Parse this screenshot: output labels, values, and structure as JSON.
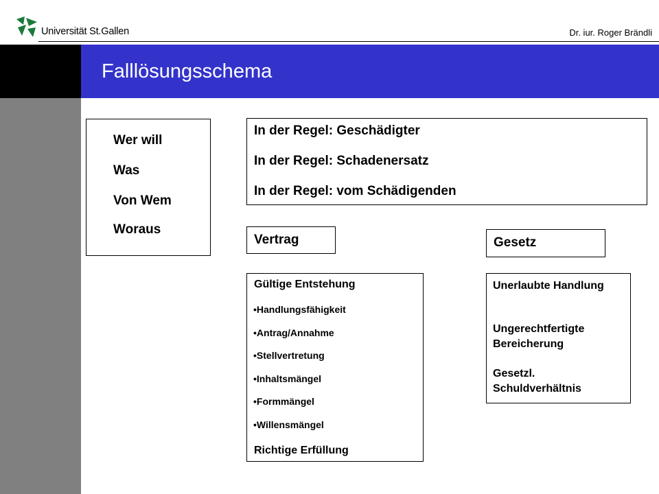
{
  "header": {
    "logo_text": "Universität St.Gallen",
    "author": "Dr. iur. Roger Brändli"
  },
  "slide": {
    "title": "Falllösungsschema"
  },
  "questions": [
    "Wer will",
    "Was",
    "Von Wem",
    "Woraus"
  ],
  "rules": [
    "In der Regel: Geschädigter",
    "In der Regel: Schadenersatz",
    "In der Regel: vom Schädigenden"
  ],
  "vertrag": {
    "label": "Vertrag",
    "heading": "Gültige Entstehung",
    "items": [
      "•Handlungsfähigkeit",
      "•Antrag/Annahme",
      "•Stellvertretung",
      "•Inhaltsmängel",
      "•Formmängel",
      "•Willensmängel"
    ],
    "footer": "Richtige Erfüllung"
  },
  "gesetz": {
    "label": "Gesetz",
    "items": [
      "Unerlaubte Handlung",
      "Ungerechtfertigte Bereicherung",
      "Gesetzl. Schuldverhältnis"
    ]
  },
  "colors": {
    "title_bar": "#3333cc",
    "side_column": "#808080",
    "logo_green": "#1a7a3a"
  }
}
